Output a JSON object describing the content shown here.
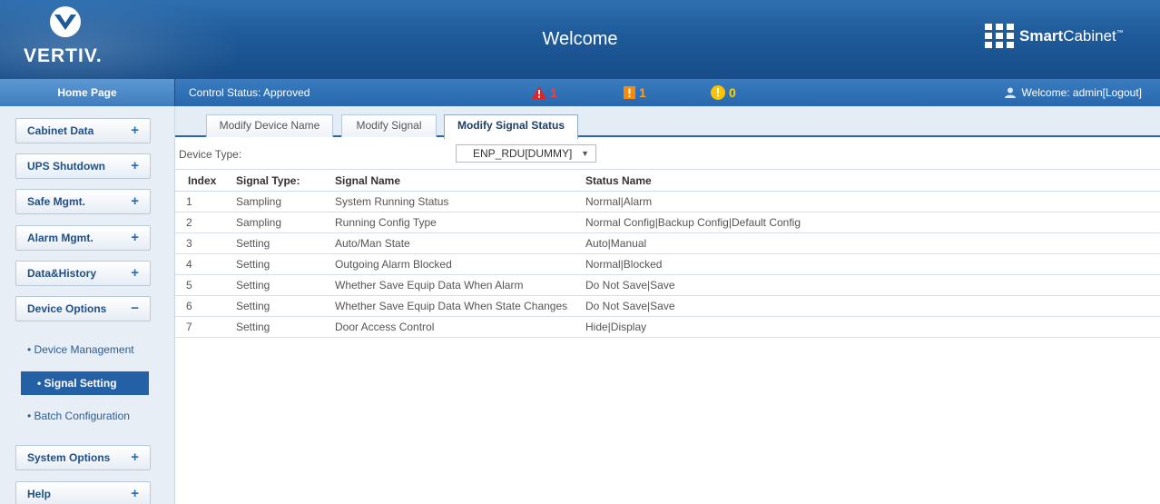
{
  "header": {
    "logo_text": "VERTIV.",
    "title": "Welcome",
    "brand_bold": "Smart",
    "brand_rest": "Cabinet",
    "brand_tm": "™"
  },
  "status_bar": {
    "home_tab": "Home Page",
    "control_status": "Control Status:  Approved",
    "alarms": {
      "critical": "1",
      "major": "1",
      "minor": "0"
    },
    "welcome_prefix": "Welcome: admin",
    "logout": "[Logout]"
  },
  "sidebar": {
    "menu": [
      {
        "label": "Cabinet Data",
        "sign": "+"
      },
      {
        "label": "UPS Shutdown",
        "sign": "+"
      },
      {
        "label": "Safe Mgmt.",
        "sign": "+"
      },
      {
        "label": "Alarm Mgmt.",
        "sign": "+"
      },
      {
        "label": "Data&History",
        "sign": "+"
      },
      {
        "label": "Device Options",
        "sign": "−"
      },
      {
        "label": "System Options",
        "sign": "+"
      },
      {
        "label": "Help",
        "sign": "+"
      }
    ],
    "sub_items": [
      "• Device Management",
      "• Signal Setting",
      "• Batch Configuration"
    ]
  },
  "tabs": [
    {
      "label": "Modify Device Name"
    },
    {
      "label": "Modify Signal"
    },
    {
      "label": "Modify Signal Status"
    }
  ],
  "device_type": {
    "label": "Device Type:",
    "selected": "ENP_RDU[DUMMY]",
    "arrow": "▼"
  },
  "table": {
    "headers": [
      "Index",
      "Signal Type:",
      "Signal Name",
      "Status Name"
    ],
    "rows": [
      [
        "1",
        "Sampling",
        "System Running Status",
        "Normal|Alarm"
      ],
      [
        "2",
        "Sampling",
        "Running Config Type",
        "Normal Config|Backup Config|Default Config"
      ],
      [
        "3",
        "Setting",
        "Auto/Man State",
        "Auto|Manual"
      ],
      [
        "4",
        "Setting",
        "Outgoing Alarm Blocked",
        "Normal|Blocked"
      ],
      [
        "5",
        "Setting",
        "Whether Save Equip Data When Alarm",
        "Do Not Save|Save"
      ],
      [
        "6",
        "Setting",
        "Whether Save Equip Data When State Changes",
        "Do Not Save|Save"
      ],
      [
        "7",
        "Setting",
        "Door Access Control",
        "Hide|Display"
      ]
    ]
  },
  "colors": {
    "header_blue": "#1e5a9a",
    "accent_blue": "#2460a6",
    "alarm_red": "#ff3b3b",
    "alarm_orange": "#ff9a1f",
    "alarm_yellow": "#ffd200"
  }
}
